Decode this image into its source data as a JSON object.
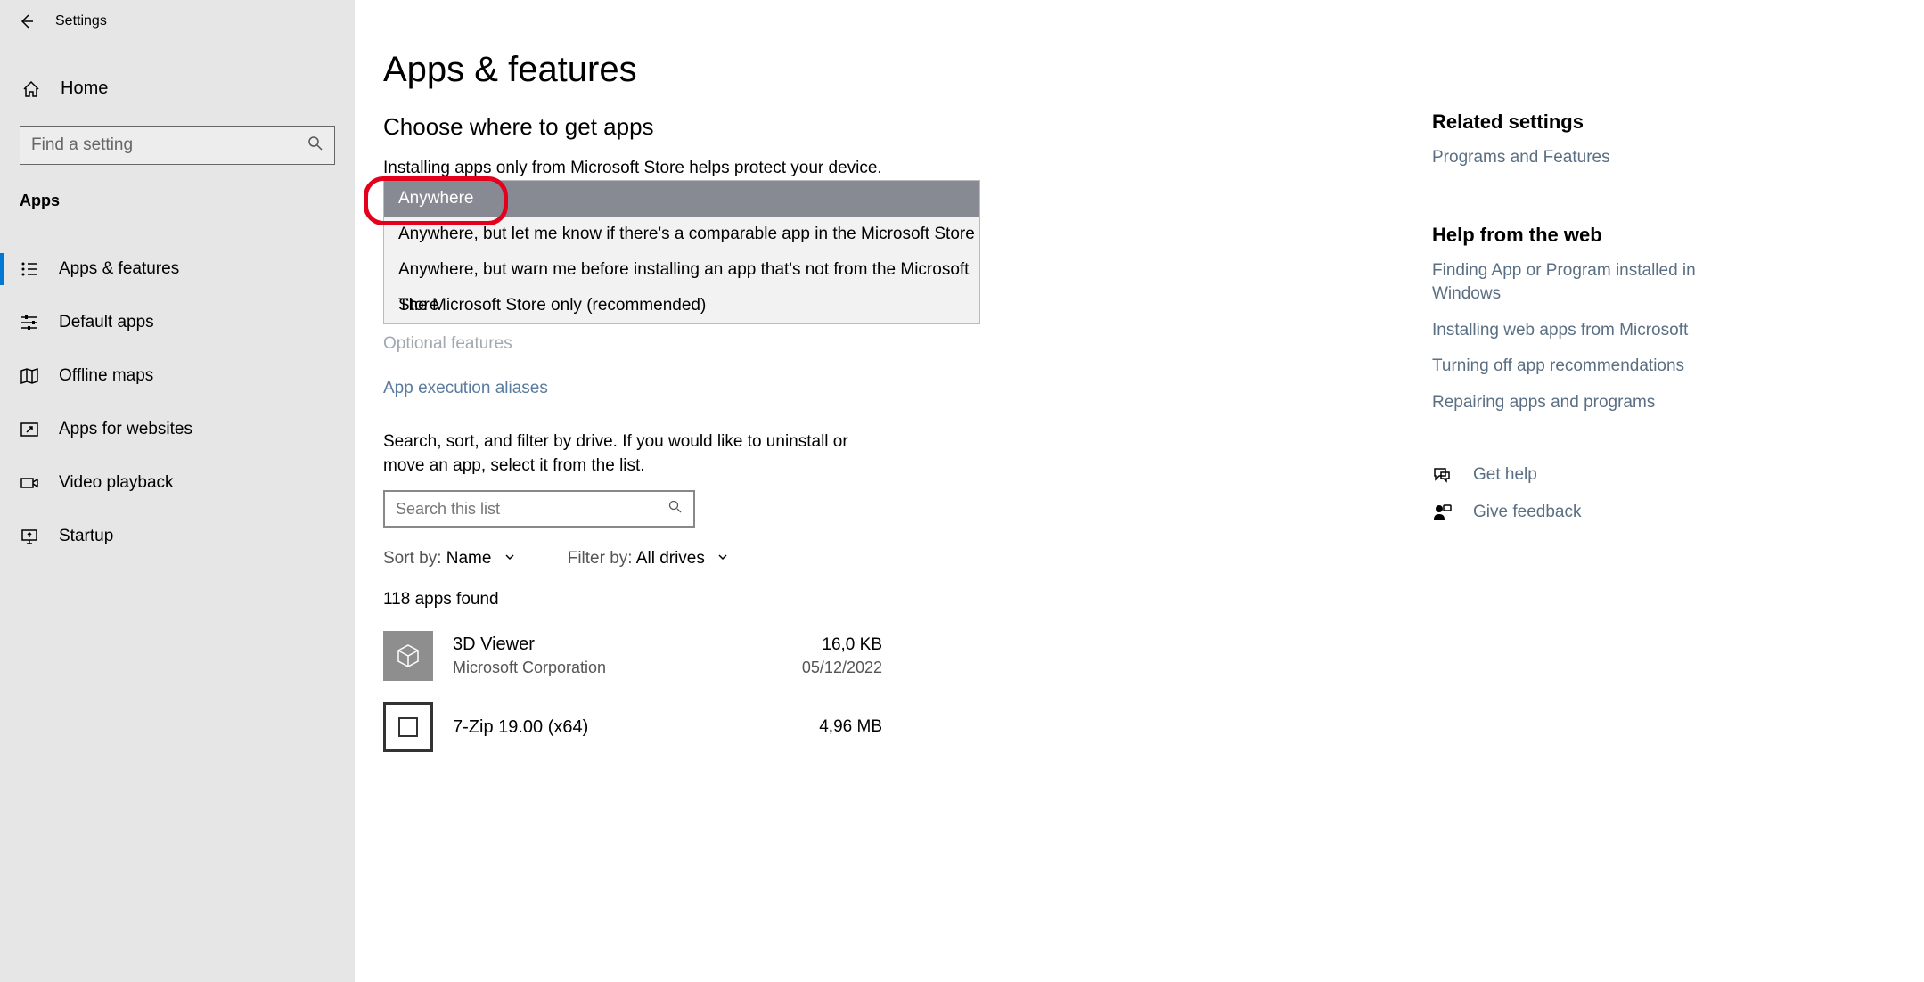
{
  "window": {
    "title": "Settings"
  },
  "sidebar": {
    "home_label": "Home",
    "search_placeholder": "Find a setting",
    "section_label": "Apps",
    "items": [
      {
        "label": "Apps & features",
        "selected": true
      },
      {
        "label": "Default apps",
        "selected": false
      },
      {
        "label": "Offline maps",
        "selected": false
      },
      {
        "label": "Apps for websites",
        "selected": false
      },
      {
        "label": "Video playback",
        "selected": false
      },
      {
        "label": "Startup",
        "selected": false
      }
    ]
  },
  "main": {
    "title": "Apps & features",
    "choose_heading": "Choose where to get apps",
    "help_text": "Installing apps only from Microsoft Store helps protect your device.",
    "dropdown": {
      "options": [
        "Anywhere",
        "Anywhere, but let me know if there's a comparable app in the Microsoft Store",
        "Anywhere, but warn me before installing an app that's not from the Microsoft Store",
        "The Microsoft Store only (recommended)"
      ],
      "highlighted_index": 0
    },
    "optional_link": "Optional features",
    "aliases_link": "App execution aliases",
    "instruction": "Search, sort, and filter by drive. If you would like to uninstall or move an app, select it from the list.",
    "list_search_placeholder": "Search this list",
    "sort_label": "Sort by: ",
    "sort_value": "Name",
    "filter_label": "Filter by: ",
    "filter_value": "All drives",
    "count_text": "118 apps found",
    "apps": [
      {
        "name": "3D Viewer",
        "publisher": "Microsoft Corporation",
        "size": "16,0 KB",
        "date": "05/12/2022",
        "icon": "cube"
      },
      {
        "name": "7-Zip 19.00 (x64)",
        "publisher": "",
        "size": "4,96 MB",
        "date": "",
        "icon": "archive"
      }
    ]
  },
  "right_panel": {
    "related_heading": "Related settings",
    "related_links": [
      "Programs and Features"
    ],
    "help_heading": "Help from the web",
    "help_links": [
      "Finding App or Program installed in Windows",
      "Installing web apps from Microsoft",
      "Turning off app recommendations",
      "Repairing apps and programs"
    ],
    "get_help": "Get help",
    "give_feedback": "Give feedback"
  }
}
